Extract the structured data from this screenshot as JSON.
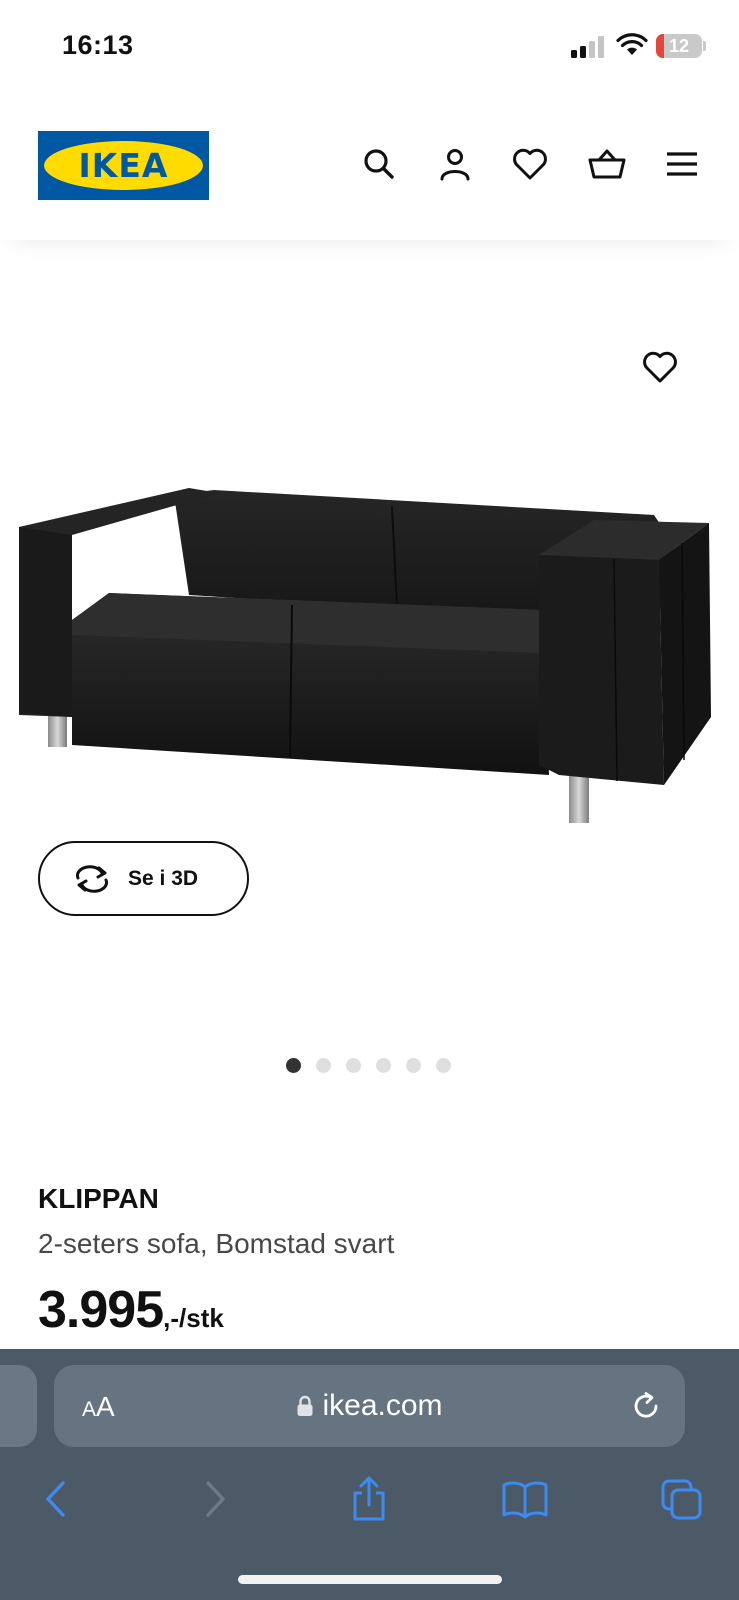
{
  "status_bar": {
    "time": "16:13",
    "battery_level": "12",
    "battery_color": "#e5463c"
  },
  "header": {
    "logo_text": "IKEA",
    "logo_colors": {
      "blue": "#0058a3",
      "yellow": "#ffdb00"
    },
    "icons": [
      "search-icon",
      "account-icon",
      "heart-icon",
      "basket-icon",
      "menu-icon"
    ]
  },
  "gallery": {
    "favourite_icon": "heart-outline-icon",
    "view_3d_label": "Se i 3D",
    "dots_total": 6,
    "dots_active": 1
  },
  "product": {
    "name": "KLIPPAN",
    "description": "2-seters sofa, Bomstad svart",
    "price_main": "3.995",
    "price_suffix": ",-/stk"
  },
  "browser": {
    "aa_label_small": "A",
    "aa_label_large": "A",
    "url": "ikea.com",
    "toolbar": [
      "back-icon",
      "forward-icon",
      "share-icon",
      "bookmarks-icon",
      "tabs-icon"
    ],
    "accent_color": "#3d8bf0"
  }
}
